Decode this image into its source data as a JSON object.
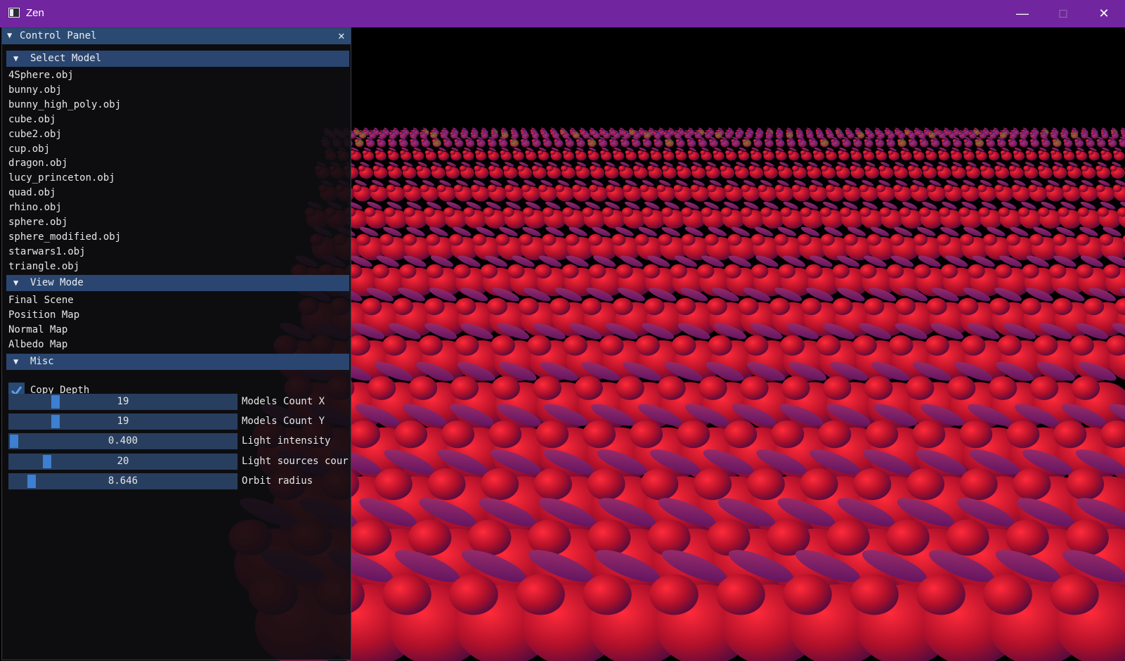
{
  "window": {
    "title": "Zen",
    "icons": {
      "app": "app-window-icon",
      "minimize": "minimize-icon",
      "maximize": "maximize-icon",
      "close": "close-icon"
    }
  },
  "panel": {
    "title": "Control Panel",
    "close_glyph": "✕",
    "sections": {
      "select_model": {
        "label": "Select Model",
        "items": [
          "4Sphere.obj",
          "bunny.obj",
          "bunny_high_poly.obj",
          "cube.obj",
          "cube2.obj",
          "cup.obj",
          "dragon.obj",
          "lucy_princeton.obj",
          "quad.obj",
          "rhino.obj",
          "sphere.obj",
          "sphere_modified.obj",
          "starwars1.obj",
          "triangle.obj"
        ]
      },
      "view_mode": {
        "label": "View Mode",
        "items": [
          "Final Scene",
          "Position Map",
          "Normal Map",
          "Albedo Map"
        ]
      },
      "misc": {
        "label": "Misc",
        "copy_depth": {
          "label": "Copy Depth",
          "checked": true
        },
        "sliders": [
          {
            "label": "Models Count X",
            "value": "19",
            "fraction": 0.19
          },
          {
            "label": "Models Count Y",
            "value": "19",
            "fraction": 0.19
          },
          {
            "label": "Light intensity",
            "value": "0.400",
            "fraction": 0.0
          },
          {
            "label": "Light sources cour",
            "value": "20",
            "fraction": 0.15
          },
          {
            "label": "Orbit radius",
            "value": "8.646",
            "fraction": 0.08
          }
        ]
      }
    }
  },
  "colors": {
    "title_bar": "#7126a0",
    "header": "#2a4670",
    "slider_grab": "#3d7fd1",
    "bunny_red": "#c8102a",
    "bunny_magenta": "#7a1a8a"
  }
}
